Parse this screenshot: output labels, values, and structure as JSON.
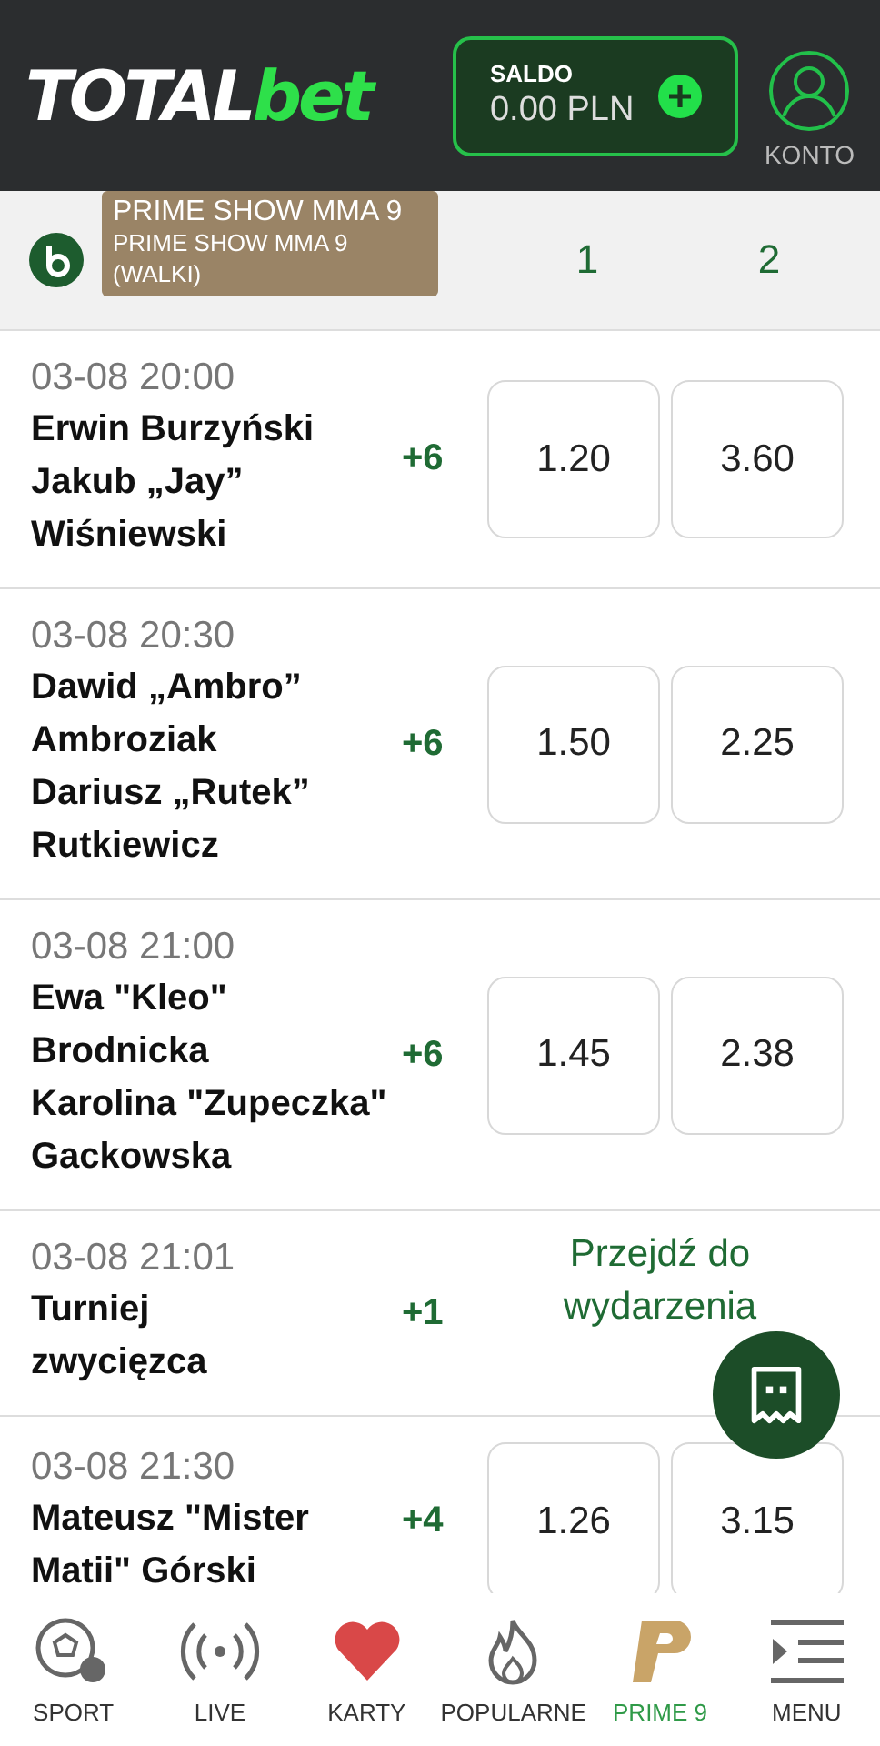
{
  "header": {
    "logo_left": "TOTAL",
    "logo_right": "bet",
    "balance": {
      "label": "SALDO",
      "value": "0.00 PLN"
    },
    "account": {
      "label": "KONTO"
    }
  },
  "league": {
    "tag_title": "PRIME SHOW MMA 9",
    "tag_subtitle": "PRIME SHOW MMA 9 (WALKI)",
    "columns": [
      "1",
      "2"
    ]
  },
  "events": [
    {
      "kind": "odds",
      "time": "03-08 20:00",
      "participants": [
        "Erwin Burzyński",
        "Jakub „Jay” Wiśniewski"
      ],
      "more": "+6",
      "odds": [
        "1.20",
        "3.60"
      ]
    },
    {
      "kind": "odds",
      "time": "03-08 20:30",
      "participants": [
        "Dawid „Ambro” Ambroziak",
        "Dariusz „Rutek” Rutkiewicz"
      ],
      "more": "+6",
      "odds": [
        "1.50",
        "2.25"
      ]
    },
    {
      "kind": "odds",
      "time": "03-08 21:00",
      "participants": [
        "Ewa \"Kleo\" Brodnicka",
        "Karolina \"Zupeczka\" Gackowska"
      ],
      "more": "+6",
      "odds": [
        "1.45",
        "2.38"
      ]
    },
    {
      "kind": "link",
      "time": "03-08 21:01",
      "participants": [
        "Turniej zwycięzca"
      ],
      "more": "+1",
      "link": "Przejdź do wydarzenia"
    },
    {
      "kind": "odds",
      "time": "03-08 21:30",
      "participants": [
        "Mateusz \"Mister Matii\" Górski"
      ],
      "more": "+4",
      "odds": [
        "1.26",
        "3.15"
      ]
    }
  ],
  "nav": [
    {
      "kind": "sport",
      "label": "SPORT",
      "selected": false
    },
    {
      "kind": "live",
      "label": "LIVE",
      "selected": false
    },
    {
      "kind": "heart",
      "label": "KARTY",
      "selected": false
    },
    {
      "kind": "fire",
      "label": "POPULARNE",
      "selected": false
    },
    {
      "kind": "prime",
      "label": "PRIME 9",
      "selected": true
    },
    {
      "kind": "menu",
      "label": "MENU",
      "selected": false
    }
  ]
}
